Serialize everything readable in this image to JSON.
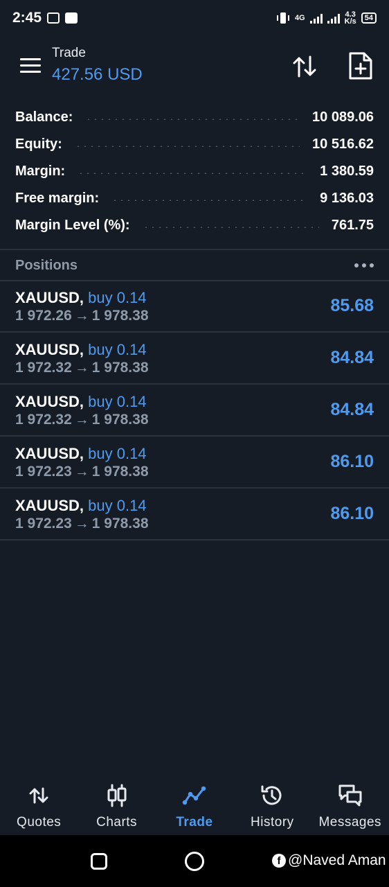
{
  "status_bar": {
    "time": "2:45",
    "network_type": "4G",
    "net_speed_value": "4.3",
    "net_speed_unit": "K/s",
    "battery": "54"
  },
  "header": {
    "title": "Trade",
    "profit": "427.56 USD"
  },
  "summary": [
    {
      "label": "Balance:",
      "value": "10 089.06"
    },
    {
      "label": "Equity:",
      "value": "10 516.62"
    },
    {
      "label": "Margin:",
      "value": "1 380.59"
    },
    {
      "label": "Free margin:",
      "value": "9 136.03"
    },
    {
      "label": "Margin Level (%):",
      "value": "761.75"
    }
  ],
  "positions_header": "Positions",
  "positions": [
    {
      "symbol": "XAUUSD,",
      "side": "buy 0.14",
      "open_price": "1 972.26",
      "arrow": "→",
      "current_price": "1 978.38",
      "profit": "85.68"
    },
    {
      "symbol": "XAUUSD,",
      "side": "buy 0.14",
      "open_price": "1 972.32",
      "arrow": "→",
      "current_price": "1 978.38",
      "profit": "84.84"
    },
    {
      "symbol": "XAUUSD,",
      "side": "buy 0.14",
      "open_price": "1 972.32",
      "arrow": "→",
      "current_price": "1 978.38",
      "profit": "84.84"
    },
    {
      "symbol": "XAUUSD,",
      "side": "buy 0.14",
      "open_price": "1 972.23",
      "arrow": "→",
      "current_price": "1 978.38",
      "profit": "86.10"
    },
    {
      "symbol": "XAUUSD,",
      "side": "buy 0.14",
      "open_price": "1 972.23",
      "arrow": "→",
      "current_price": "1 978.38",
      "profit": "86.10"
    }
  ],
  "bottom_nav": [
    {
      "label": "Quotes",
      "icon": "arrows-updown-icon",
      "active": false
    },
    {
      "label": "Charts",
      "icon": "candlestick-icon",
      "active": false
    },
    {
      "label": "Trade",
      "icon": "trade-line-icon",
      "active": true
    },
    {
      "label": "History",
      "icon": "history-clock-icon",
      "active": false
    },
    {
      "label": "Messages",
      "icon": "messages-icon",
      "active": false
    }
  ],
  "watermark": "@Naved Aman",
  "colors": {
    "background": "#151c26",
    "accent": "#4f9bf0",
    "muted": "#8f9aa8",
    "divider": "#2a333e"
  }
}
